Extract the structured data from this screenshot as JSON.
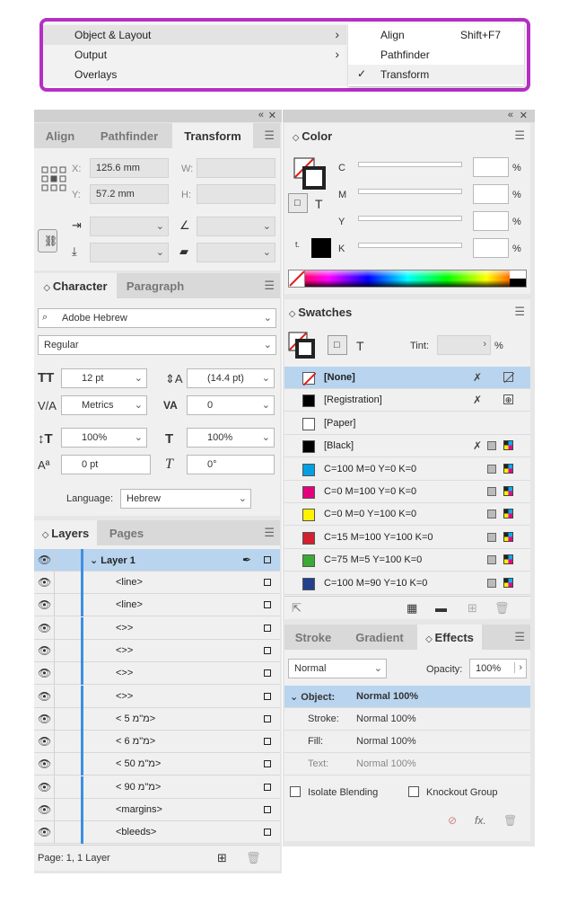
{
  "menu": {
    "items": [
      {
        "label": "Object & Layout",
        "arrow": "›"
      },
      {
        "label": "Output",
        "arrow": "›"
      },
      {
        "label": "Overlays",
        "arrow": ""
      }
    ],
    "submenu": [
      {
        "label": "Align",
        "shortcut": "Shift+F7",
        "check": ""
      },
      {
        "label": "Pathfinder",
        "shortcut": "",
        "check": ""
      },
      {
        "label": "Transform",
        "shortcut": "",
        "check": "✓"
      }
    ]
  },
  "left_top_tabs": [
    "Align",
    "Pathfinder",
    "Transform"
  ],
  "transform": {
    "x_label": "X:",
    "x_value": "125.6 mm",
    "y_label": "Y:",
    "y_value": "57.2 mm",
    "w_label": "W:",
    "h_label": "H:"
  },
  "character_tabs": [
    "Character",
    "Paragraph"
  ],
  "character": {
    "font": "Adobe Hebrew",
    "style": "Regular",
    "size": "12 pt",
    "leading": "(14.4 pt)",
    "kerning": "Metrics",
    "tracking": "0",
    "vscale": "100%",
    "hscale": "100%",
    "baseline": "0 pt",
    "skew": "0°",
    "language_label": "Language:",
    "language": "Hebrew"
  },
  "layers_tabs": [
    "Layers",
    "Pages"
  ],
  "layers": {
    "layer_name": "Layer 1",
    "items": [
      "<line>",
      "<line>",
      "<>>",
      "<>>",
      "<>>",
      "<>>",
      "< 5 מ\"מ>",
      "< 6 מ\"מ>",
      "< 50 מ\"מ>",
      "< 90 מ\"מ>",
      "<margins>",
      "<bleeds>"
    ],
    "status": "Page: 1, 1 Layer"
  },
  "color_panel": {
    "title": "Color",
    "labels": [
      "C",
      "M",
      "Y",
      "K"
    ],
    "percent": "%"
  },
  "swatches": {
    "title": "Swatches",
    "tint_label": "Tint:",
    "percent": "%",
    "items": [
      {
        "name": "[None]",
        "color": "#ffffff"
      },
      {
        "name": "[Registration]",
        "color": "#000000"
      },
      {
        "name": "[Paper]",
        "color": "#ffffff"
      },
      {
        "name": "[Black]",
        "color": "#000000"
      },
      {
        "name": "C=100 M=0 Y=0 K=0",
        "color": "#00a0e3"
      },
      {
        "name": "C=0 M=100 Y=0 K=0",
        "color": "#e6007e"
      },
      {
        "name": "C=0 M=0 Y=100 K=0",
        "color": "#fff100"
      },
      {
        "name": "C=15 M=100 Y=100 K=0",
        "color": "#d2202f"
      },
      {
        "name": "C=75 M=5 Y=100 K=0",
        "color": "#3aa935"
      },
      {
        "name": "C=100 M=90 Y=10 K=0",
        "color": "#23408e"
      }
    ]
  },
  "effects_tabs": [
    "Stroke",
    "Gradient",
    "Effects"
  ],
  "effects": {
    "mode": "Normal",
    "opacity_label": "Opacity:",
    "opacity": "100%",
    "rows": [
      {
        "label": "Object:",
        "value": "Normal 100%"
      },
      {
        "label": "Stroke:",
        "value": "Normal 100%"
      },
      {
        "label": "Fill:",
        "value": "Normal 100%"
      },
      {
        "label": "Text:",
        "value": "Normal 100%"
      }
    ],
    "isolate": "Isolate Blending",
    "knockout": "Knockout Group"
  }
}
